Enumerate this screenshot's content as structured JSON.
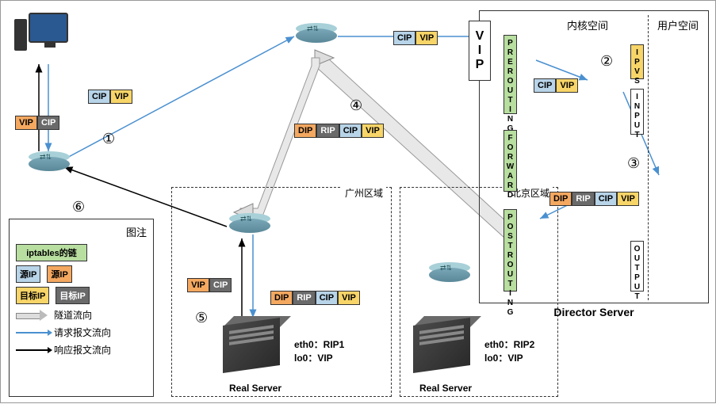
{
  "legend": {
    "title": "图注",
    "iptables": "iptables的链",
    "srcIP_blue": "源IP",
    "srcIP_orange": "源IP",
    "dstIP_yellow": "目标IP",
    "dstIP_gray": "目标IP",
    "tunnel": "隧道流向",
    "request": "请求报文流向",
    "response": "响应报文流向"
  },
  "tags": {
    "CIP": "CIP",
    "VIP": "VIP",
    "DIP": "DIP",
    "RIP": "RIP"
  },
  "regions": {
    "guangzhou": "广州区域",
    "beijing": "北京区域"
  },
  "director": {
    "title": "Director Server",
    "kernel": "内核空间",
    "user": "用户空间",
    "vip": "VIP",
    "prerouting": "PREROUTING",
    "forward": "FORWARD",
    "postrouting": "POSTROUTING",
    "ipvs": "IPVS",
    "input": "INPUT",
    "output": "OUTPUT"
  },
  "servers": {
    "real": "Real Server",
    "eth0_1": "eth0：RIP1",
    "eth0_2": "eth0：RIP2",
    "lo0": "lo0：VIP"
  },
  "steps": {
    "s1": "①",
    "s2": "②",
    "s3": "③",
    "s4": "④",
    "s5": "⑤",
    "s6": "⑥"
  }
}
